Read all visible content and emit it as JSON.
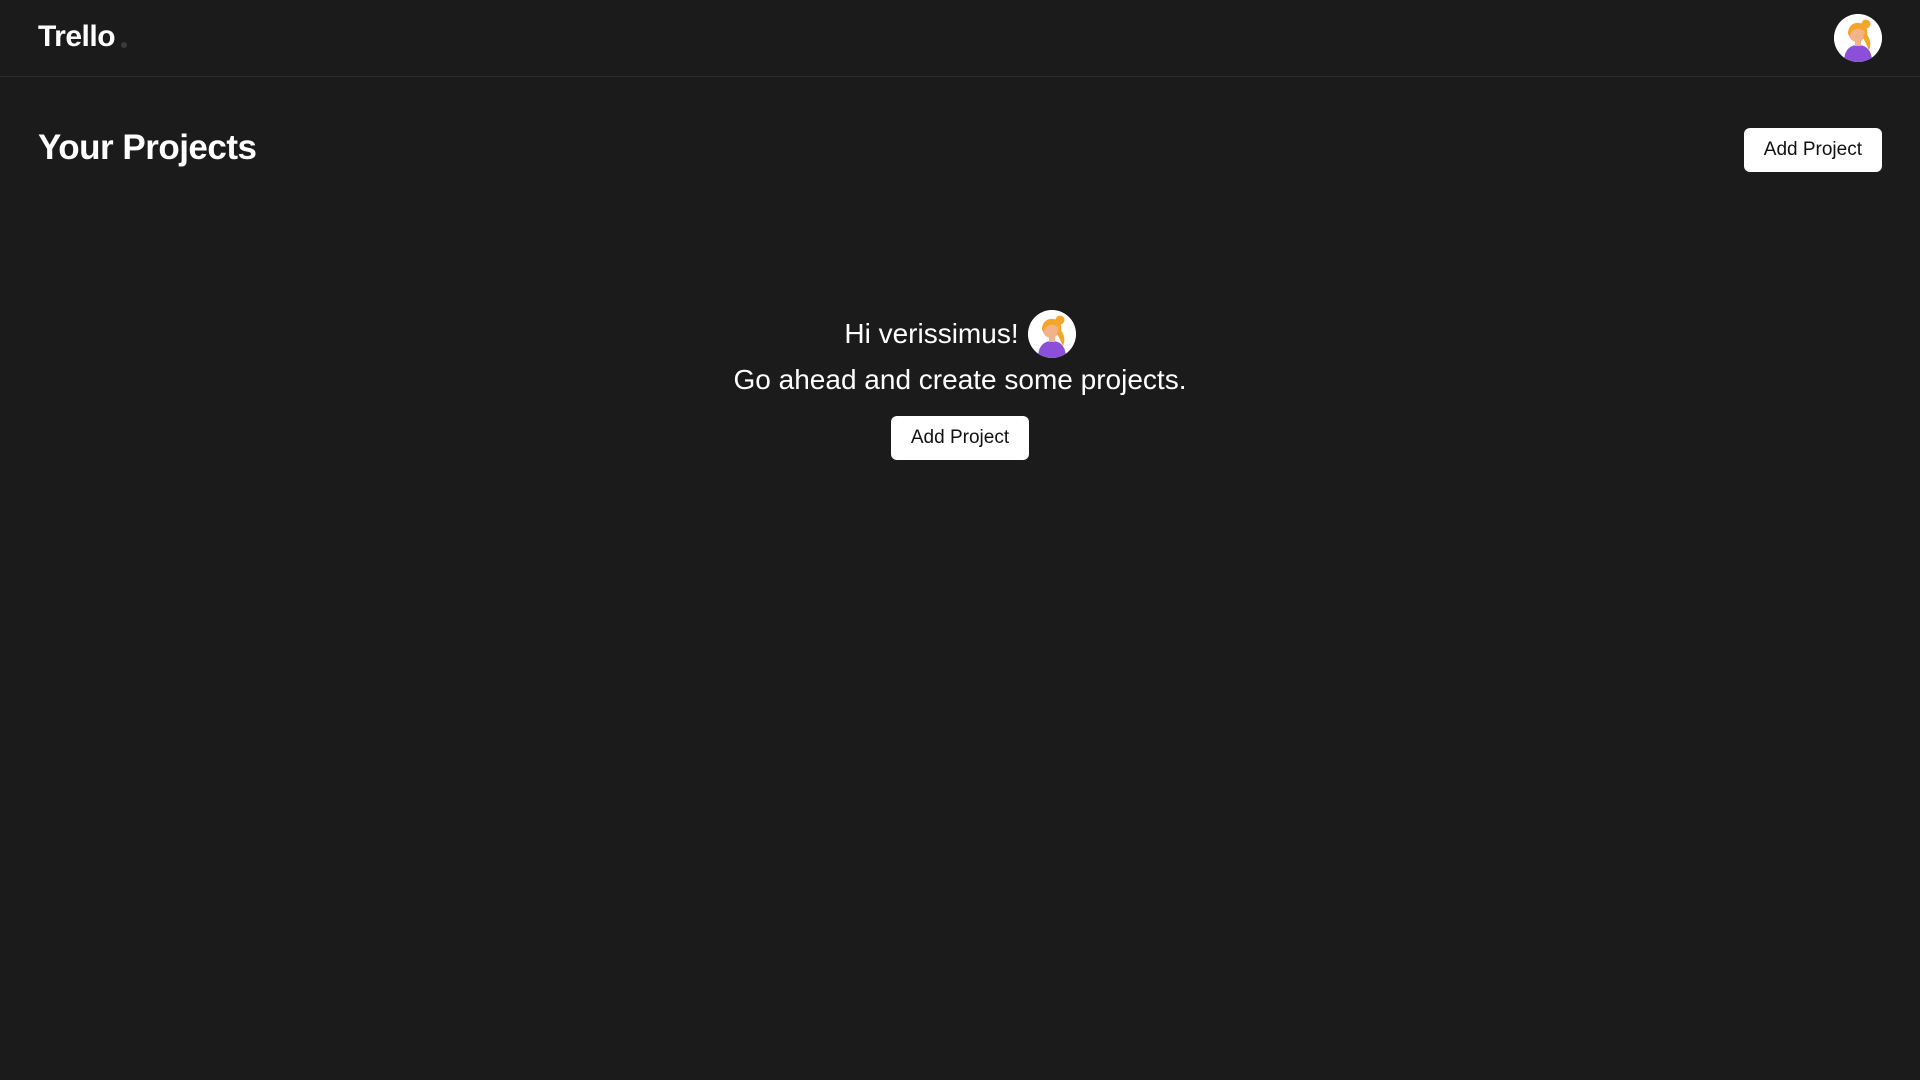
{
  "header": {
    "logo_text": "Trello",
    "avatar_icon": "user-avatar-icon"
  },
  "main": {
    "title": "Your Projects",
    "add_project_label": "Add Project"
  },
  "empty_state": {
    "greeting": "Hi verissimus!",
    "message": "Go ahead and create some projects.",
    "add_project_label": "Add Project"
  },
  "colors": {
    "background": "#1b1b1b",
    "text": "#ffffff",
    "button_bg": "#ffffff",
    "button_text": "#111111",
    "avatar_hair": "#f4a62a",
    "avatar_shirt": "#8b4fd9"
  }
}
